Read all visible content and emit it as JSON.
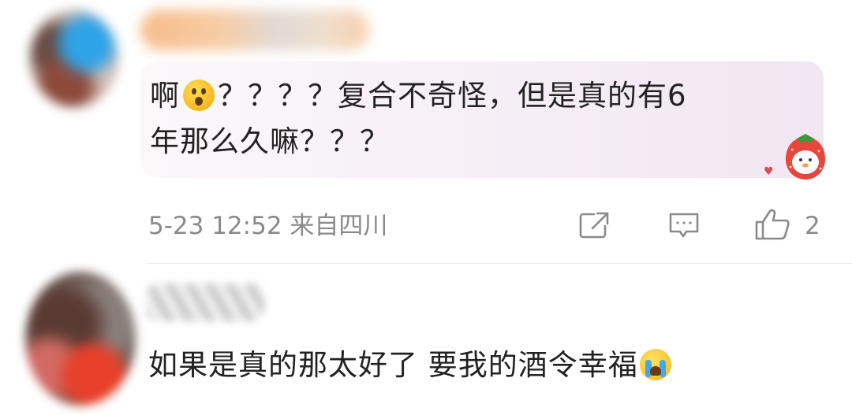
{
  "comments": [
    {
      "text_line1_pre": "啊",
      "emoji1": "astonished-face-emoji",
      "text_line1_post": "？？？？复合不奇怪，但是真的有6",
      "text_line2": "年那么久嘛？？？",
      "sticker": "strawberry-sticker",
      "timestamp": "5-23 12:52 来自四川",
      "like_count": "2"
    },
    {
      "text": "如果是真的那太好了 要我的酒令幸福",
      "emoji": "loudly-crying-face-emoji"
    }
  ],
  "icons": {
    "share": "share-icon",
    "comment": "comment-icon",
    "like": "thumbs-up-icon"
  },
  "colors": {
    "bubble": "#f6eef6",
    "meta_text": "#8a8a8a",
    "text": "#222222"
  }
}
